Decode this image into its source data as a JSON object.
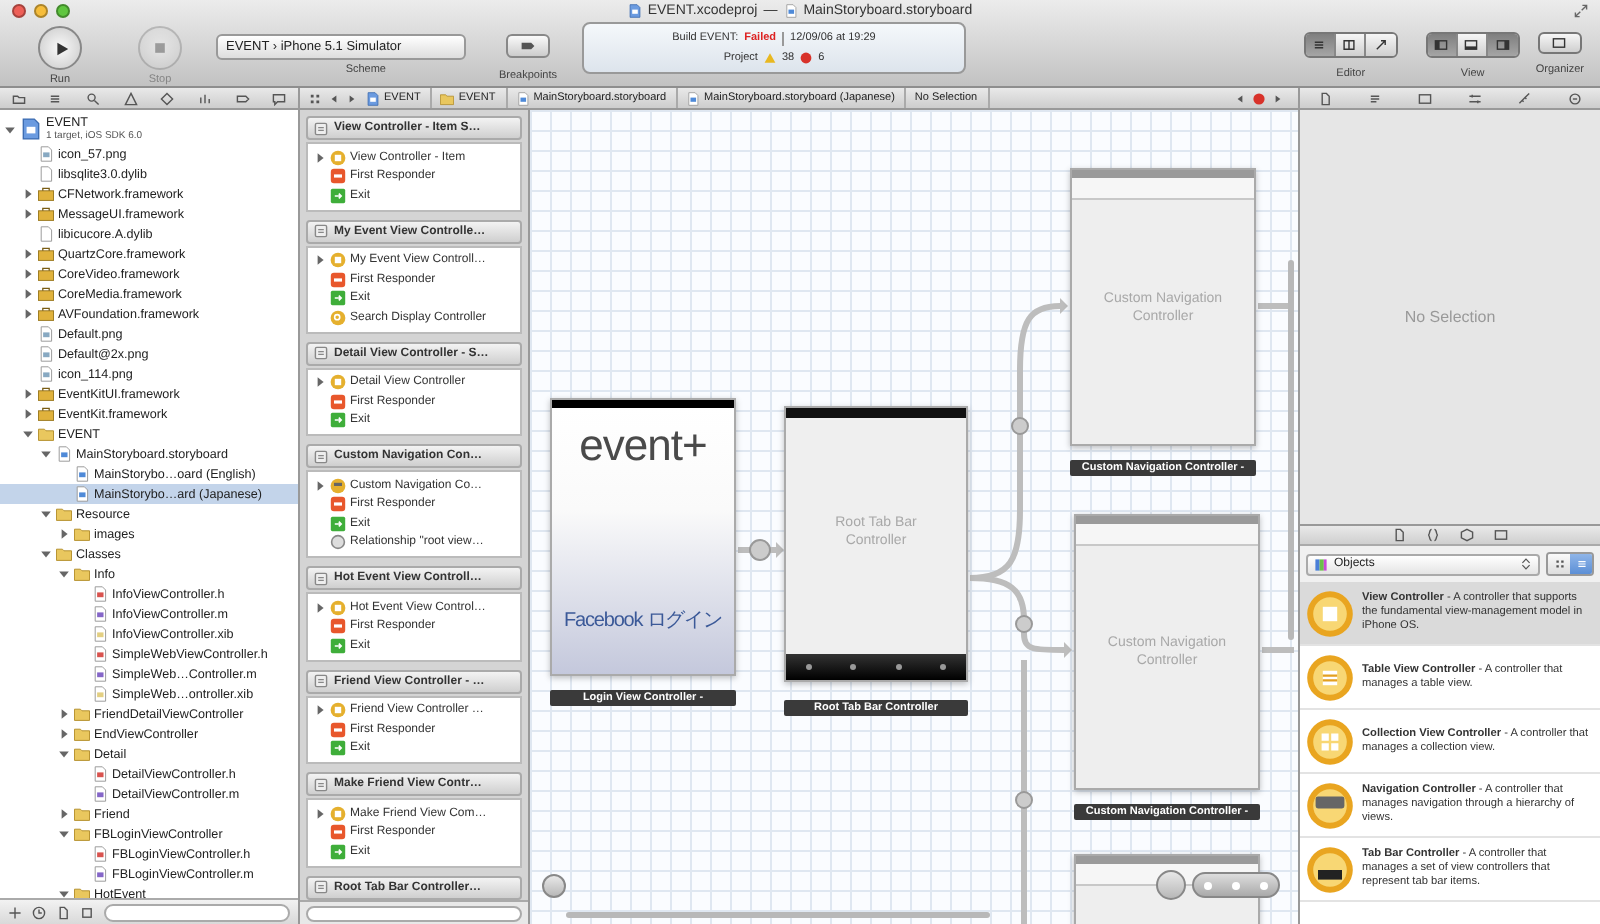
{
  "window": {
    "project": "EVENT.xcodeproj",
    "separator": "—",
    "document": "MainStoryboard.storyboard"
  },
  "toolbar": {
    "run_label": "Run",
    "stop_label": "Stop",
    "stop_disabled": true,
    "scheme": "EVENT › iPhone 5.1 Simulator",
    "scheme_label": "Scheme",
    "breakpoints_label": "Breakpoints",
    "editor_label": "Editor",
    "editor_modes": [
      {
        "selected": true
      },
      {
        "selected": false
      },
      {
        "selected": false
      }
    ],
    "view_label": "View",
    "view_panes": [
      {
        "selected": true
      },
      {
        "selected": false
      },
      {
        "selected": true
      }
    ],
    "organizer_label": "Organizer"
  },
  "activity": {
    "action": "Build EVENT:",
    "result": "Failed",
    "time": "12/09/06 at 19:29",
    "project_label": "Project",
    "warnings": "38",
    "errors": "6"
  },
  "jump_bar": [
    {
      "kind": "project",
      "label": "EVENT"
    },
    {
      "kind": "folder",
      "label": "EVENT"
    },
    {
      "kind": "storyboard",
      "label": "MainStoryboard.storyboard"
    },
    {
      "kind": "storyboard",
      "label": "MainStoryboard.storyboard (Japanese)"
    },
    {
      "kind": "plain",
      "label": "No Selection"
    }
  ],
  "navigator": {
    "tree": [
      {
        "kind": "project",
        "label": "EVENT",
        "subtitle": "1 target, iOS SDK 6.0",
        "expanded": true,
        "selected": false,
        "children": [
          {
            "kind": "image",
            "label": "icon_57.png",
            "selected": false
          },
          {
            "kind": "dylib",
            "label": "libsqlite3.0.dylib",
            "selected": false
          },
          {
            "kind": "framework",
            "label": "CFNetwork.framework",
            "expanded": false,
            "selected": false
          },
          {
            "kind": "framework",
            "label": "MessageUI.framework",
            "expanded": false,
            "selected": false
          },
          {
            "kind": "dylib",
            "label": "libicucore.A.dylib",
            "selected": false
          },
          {
            "kind": "framework",
            "label": "QuartzCore.framework",
            "expanded": false,
            "selected": false
          },
          {
            "kind": "framework",
            "label": "CoreVideo.framework",
            "expanded": false,
            "selected": false
          },
          {
            "kind": "framework",
            "label": "CoreMedia.framework",
            "expanded": false,
            "selected": false
          },
          {
            "kind": "framework",
            "label": "AVFoundation.framework",
            "expanded": false,
            "selected": false
          },
          {
            "kind": "image",
            "label": "Default.png",
            "selected": false
          },
          {
            "kind": "image",
            "label": "Default@2x.png",
            "selected": false
          },
          {
            "kind": "image",
            "label": "icon_114.png",
            "selected": false
          },
          {
            "kind": "framework",
            "label": "EventKitUI.framework",
            "expanded": false,
            "selected": false
          },
          {
            "kind": "framework",
            "label": "EventKit.framework",
            "expanded": false,
            "selected": false
          },
          {
            "kind": "folder",
            "label": "EVENT",
            "expanded": true,
            "selected": false,
            "children": [
              {
                "kind": "storyboard",
                "label": "MainStoryboard.storyboard",
                "expanded": true,
                "selected": false,
                "children": [
                  {
                    "kind": "storyboard",
                    "label": "MainStorybo…oard (English)",
                    "selected": false
                  },
                  {
                    "kind": "storyboard",
                    "label": "MainStorybo…ard (Japanese)",
                    "selected": true
                  }
                ]
              },
              {
                "kind": "folder",
                "label": "Resource",
                "expanded": true,
                "selected": false,
                "children": [
                  {
                    "kind": "folder",
                    "label": "images",
                    "expanded": false,
                    "selected": false
                  }
                ]
              },
              {
                "kind": "folder",
                "label": "Classes",
                "expanded": true,
                "selected": false,
                "children": [
                  {
                    "kind": "folder",
                    "label": "Info",
                    "expanded": true,
                    "selected": false,
                    "children": [
                      {
                        "kind": "header",
                        "label": "InfoViewController.h",
                        "selected": false
                      },
                      {
                        "kind": "impl",
                        "label": "InfoViewController.m",
                        "selected": false
                      },
                      {
                        "kind": "xib",
                        "label": "InfoViewController.xib",
                        "selected": false
                      },
                      {
                        "kind": "header",
                        "label": "SimpleWebViewController.h",
                        "selected": false
                      },
                      {
                        "kind": "impl",
                        "label": "SimpleWeb…Controller.m",
                        "selected": false
                      },
                      {
                        "kind": "xib",
                        "label": "SimpleWeb…ontroller.xib",
                        "selected": false
                      }
                    ]
                  },
                  {
                    "kind": "folder",
                    "label": "FriendDetailViewController",
                    "expanded": false,
                    "selected": false
                  },
                  {
                    "kind": "folder",
                    "label": "EndViewController",
                    "expanded": false,
                    "selected": false
                  },
                  {
                    "kind": "folder",
                    "label": "Detail",
                    "expanded": true,
                    "selected": false,
                    "children": [
                      {
                        "kind": "header",
                        "label": "DetailViewController.h",
                        "selected": false
                      },
                      {
                        "kind": "impl",
                        "label": "DetailViewController.m",
                        "selected": false
                      }
                    ]
                  },
                  {
                    "kind": "folder",
                    "label": "Friend",
                    "expanded": false,
                    "selected": false
                  },
                  {
                    "kind": "folder",
                    "label": "FBLoginViewController",
                    "expanded": true,
                    "selected": false,
                    "children": [
                      {
                        "kind": "header",
                        "label": "FBLoginViewController.h",
                        "selected": false
                      },
                      {
                        "kind": "impl",
                        "label": "FBLoginViewController.m",
                        "selected": false
                      }
                    ]
                  },
                  {
                    "kind": "folder",
                    "label": "HotEvent",
                    "expanded": true,
                    "selected": false
                  }
                ]
              }
            ]
          }
        ]
      }
    ]
  },
  "scenes": [
    {
      "title": "View Controller - Item S…",
      "items": [
        {
          "kind": "controller",
          "label": "View Controller - Item"
        },
        {
          "kind": "responder",
          "label": "First Responder"
        },
        {
          "kind": "exit",
          "label": "Exit"
        }
      ]
    },
    {
      "title": "My Event View Controlle…",
      "items": [
        {
          "kind": "controller",
          "label": "My Event View Controll…"
        },
        {
          "kind": "responder",
          "label": "First Responder"
        },
        {
          "kind": "exit",
          "label": "Exit"
        },
        {
          "kind": "search",
          "label": "Search Display Controller"
        }
      ]
    },
    {
      "title": "Detail View Controller - S…",
      "items": [
        {
          "kind": "controller",
          "label": "Detail View Controller"
        },
        {
          "kind": "responder",
          "label": "First Responder"
        },
        {
          "kind": "exit",
          "label": "Exit"
        }
      ]
    },
    {
      "title": "Custom Navigation Con…",
      "items": [
        {
          "kind": "navigation",
          "label": "Custom Navigation Co…"
        },
        {
          "kind": "responder",
          "label": "First Responder"
        },
        {
          "kind": "exit",
          "label": "Exit"
        },
        {
          "kind": "relationship",
          "label": "Relationship \"root view…"
        }
      ]
    },
    {
      "title": "Hot Event View Controll…",
      "items": [
        {
          "kind": "controller",
          "label": "Hot Event View Control…"
        },
        {
          "kind": "responder",
          "label": "First Responder"
        },
        {
          "kind": "exit",
          "label": "Exit"
        }
      ]
    },
    {
      "title": "Friend View Controller - …",
      "items": [
        {
          "kind": "controller",
          "label": "Friend View Controller …"
        },
        {
          "kind": "responder",
          "label": "First Responder"
        },
        {
          "kind": "exit",
          "label": "Exit"
        }
      ]
    },
    {
      "title": "Make Friend View Contr…",
      "items": [
        {
          "kind": "controller",
          "label": "Make Friend View Com…"
        },
        {
          "kind": "responder",
          "label": "First Responder"
        },
        {
          "kind": "exit",
          "label": "Exit"
        }
      ]
    },
    {
      "title": "Root Tab Bar Controller…"
    }
  ],
  "canvas": {
    "scenes": [
      {
        "kind": "login",
        "logo": "event+",
        "button": "Facebook ログイン",
        "label": "Login View Controller -"
      },
      {
        "kind": "tabbar",
        "placeholder": "Root Tab Bar Controller",
        "label": "Root Tab Bar Controller"
      },
      {
        "kind": "navigation",
        "placeholder": "Custom Navigation Controller",
        "label": "Custom Navigation Controller -"
      },
      {
        "kind": "navigation",
        "placeholder": "Custom Navigation Controller",
        "label": "Custom Navigation Controller -"
      },
      {
        "kind": "blank"
      }
    ]
  },
  "inspector": {
    "empty": "No Selection"
  },
  "library": {
    "filter": "Objects",
    "view_modes": [
      {
        "selected": false
      },
      {
        "selected": true
      }
    ],
    "items": [
      {
        "kind": "view",
        "description": "**View Controller** - A controller that supports the fundamental view-management model in iPhone OS.",
        "selected": true
      },
      {
        "kind": "table",
        "description": "**Table View Controller** - A controller that manages a table view.",
        "selected": false
      },
      {
        "kind": "collection",
        "description": "**Collection View Controller** - A controller that manages a collection view.",
        "selected": false
      },
      {
        "kind": "navigation",
        "description": "**Navigation Controller** - A controller that manages navigation through a hierarchy of views.",
        "selected": false
      },
      {
        "kind": "tabbar",
        "description": "**Tab Bar Controller** - A controller that manages a set of view controllers that represent tab bar items.",
        "selected": false
      }
    ]
  }
}
